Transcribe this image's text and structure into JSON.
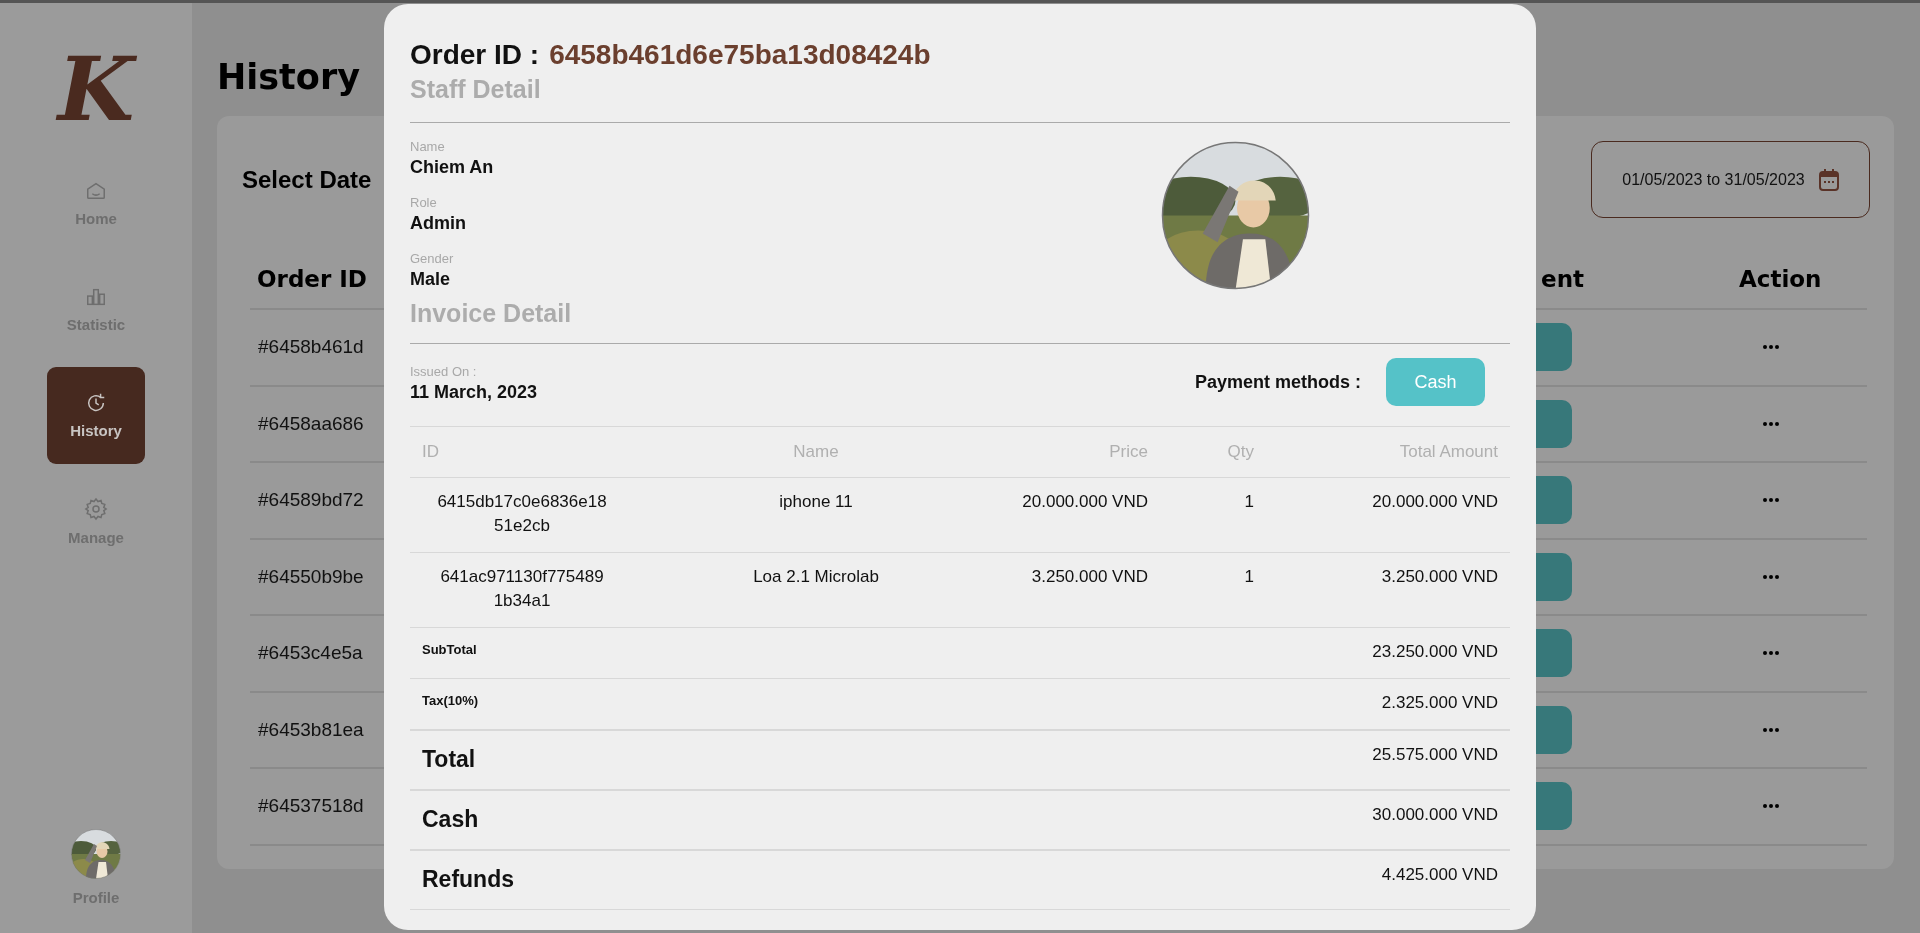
{
  "sidebar": {
    "logo": "K",
    "items": [
      {
        "label": "Home",
        "selected": false
      },
      {
        "label": "Statistic",
        "selected": false
      },
      {
        "label": "History",
        "selected": true
      },
      {
        "label": "Manage",
        "selected": false
      }
    ],
    "profile": {
      "label": "Profile"
    }
  },
  "page": {
    "title": "History",
    "select_date_label": "Select Date",
    "date_range": "01/05/2023 to 31/05/2023",
    "table": {
      "columns": [
        {
          "label": "Order ID"
        },
        {
          "label": "ent"
        },
        {
          "label": "Action"
        }
      ],
      "rows": [
        {
          "order_id": "#6458b461d"
        },
        {
          "order_id": "#6458aa686"
        },
        {
          "order_id": "#64589bd72"
        },
        {
          "order_id": "#64550b9be"
        },
        {
          "order_id": "#6453c4e5a"
        },
        {
          "order_id": "#6453b81ea"
        },
        {
          "order_id": "#64537518d"
        }
      ]
    }
  },
  "modal": {
    "order_label": "Order ID :",
    "order_id": "6458b461d6e75ba13d08424b",
    "staff_heading": "Staff Detail",
    "staff_fields": [
      {
        "label": "Name",
        "value": "Chiem An"
      },
      {
        "label": "Role",
        "value": "Admin"
      },
      {
        "label": "Gender",
        "value": "Male"
      }
    ],
    "invoice_heading": "Invoice Detail",
    "issued_label": "Issued On :",
    "issued_date": "11 March, 2023",
    "payment_label": "Payment methods :",
    "payment_method": "Cash",
    "items": {
      "columns": [
        "ID",
        "Name",
        "Price",
        "Qty",
        "Total Amount"
      ],
      "rows": [
        {
          "id": "6415db17c0e6836e18 51e2cb",
          "name": "iphone 11",
          "price": "20.000.000 VND",
          "qty": "1",
          "total": "20.000.000 VND"
        },
        {
          "id": "641ac971130f775489 1b34a1",
          "name": "Loa 2.1 Microlab",
          "price": "3.250.000 VND",
          "qty": "1",
          "total": "3.250.000 VND"
        }
      ]
    },
    "summary": [
      {
        "kind": "minor",
        "label": "SubTotal",
        "value": "23.250.000 VND"
      },
      {
        "kind": "minor",
        "label": "Tax(10%)",
        "value": "2.325.000 VND"
      },
      {
        "kind": "major",
        "label": "Total",
        "value": "25.575.000 VND"
      },
      {
        "kind": "major",
        "label": "Cash",
        "value": "30.000.000 VND"
      },
      {
        "kind": "major",
        "label": "Refunds",
        "value": "4.425.000 VND"
      }
    ]
  }
}
